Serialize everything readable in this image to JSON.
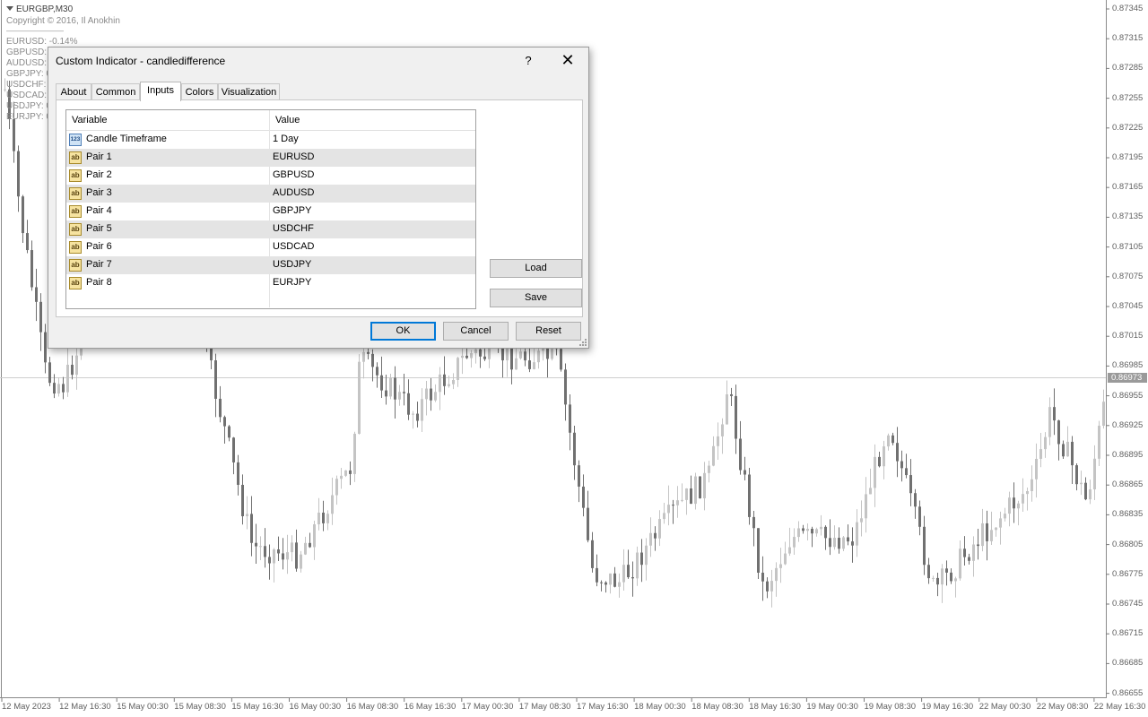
{
  "chart": {
    "symbol_title": "EURGBP,M30",
    "copyright": "Copyright © 2016, Il Anokhin",
    "separator": "————————",
    "overlay_lines": [
      "EURUSD: -0.14%",
      "GBPUSD:",
      "AUDUSD:",
      "GBPJPY: 0",
      "USDCHF:",
      "USDCAD:",
      "USDJPY: 0",
      "EURJPY: 0"
    ],
    "price_labels": [
      "0.87345",
      "0.87315",
      "0.87285",
      "0.87255",
      "0.87225",
      "0.87195",
      "0.87165",
      "0.87135",
      "0.87105",
      "0.87075",
      "0.87045",
      "0.87015",
      "0.86985",
      "0.86955",
      "0.86925",
      "0.86895",
      "0.86865",
      "0.86835",
      "0.86805",
      "0.86775",
      "0.86745",
      "0.86715",
      "0.86685",
      "0.86655"
    ],
    "current_price": "0.86973",
    "time_labels": [
      "12 May 2023",
      "12 May 16:30",
      "15 May 00:30",
      "15 May 08:30",
      "15 May 16:30",
      "16 May 00:30",
      "16 May 08:30",
      "16 May 16:30",
      "17 May 00:30",
      "17 May 08:30",
      "17 May 16:30",
      "18 May 00:30",
      "18 May 08:30",
      "18 May 16:30",
      "19 May 00:30",
      "19 May 08:30",
      "19 May 16:30",
      "22 May 00:30",
      "22 May 08:30",
      "22 May 16:30"
    ],
    "colors": {
      "bull": "#c4c4c4",
      "bear": "#707070",
      "axis": "#7a7a7a"
    }
  },
  "dialog": {
    "title": "Custom Indicator - candledifference",
    "help_label": "?",
    "close_label": "✕",
    "tabs": [
      {
        "label": "About",
        "active": false
      },
      {
        "label": "Common",
        "active": false
      },
      {
        "label": "Inputs",
        "active": true
      },
      {
        "label": "Colors",
        "active": false
      },
      {
        "label": "Visualization",
        "active": false
      }
    ],
    "grid": {
      "col_variable": "Variable",
      "col_value": "Value",
      "rows": [
        {
          "icon": "number-icon",
          "icon_text": "123",
          "variable": "Candle Timeframe",
          "value": "1 Day"
        },
        {
          "icon": "text-icon",
          "icon_text": "ab",
          "variable": "Pair 1",
          "value": "EURUSD"
        },
        {
          "icon": "text-icon",
          "icon_text": "ab",
          "variable": "Pair 2",
          "value": "GBPUSD"
        },
        {
          "icon": "text-icon",
          "icon_text": "ab",
          "variable": "Pair 3",
          "value": "AUDUSD"
        },
        {
          "icon": "text-icon",
          "icon_text": "ab",
          "variable": "Pair 4",
          "value": "GBPJPY"
        },
        {
          "icon": "text-icon",
          "icon_text": "ab",
          "variable": "Pair 5",
          "value": "USDCHF"
        },
        {
          "icon": "text-icon",
          "icon_text": "ab",
          "variable": "Pair 6",
          "value": "USDCAD"
        },
        {
          "icon": "text-icon",
          "icon_text": "ab",
          "variable": "Pair 7",
          "value": "USDJPY"
        },
        {
          "icon": "text-icon",
          "icon_text": "ab",
          "variable": "Pair 8",
          "value": "EURJPY"
        }
      ]
    },
    "load_label": "Load",
    "save_label": "Save",
    "ok_label": "OK",
    "cancel_label": "Cancel",
    "reset_label": "Reset"
  }
}
